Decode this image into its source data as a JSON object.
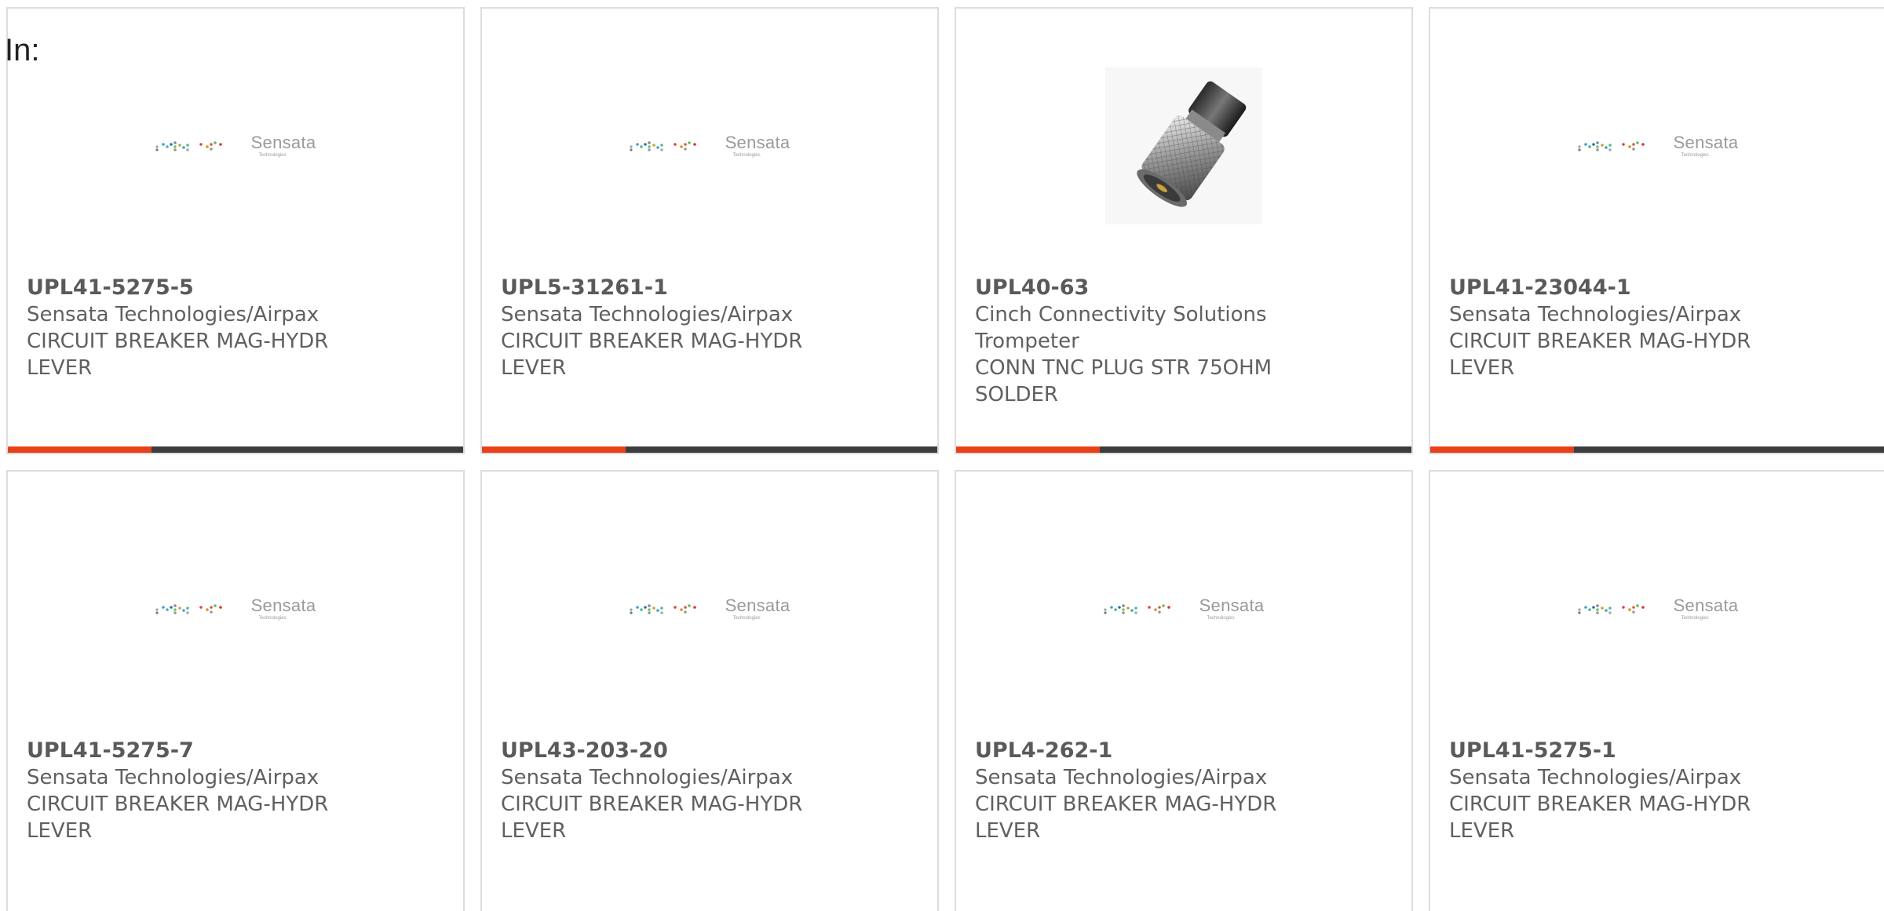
{
  "page": {
    "heading": "In:"
  },
  "logo": {
    "brand": "Sensata",
    "sub": "Technologies"
  },
  "colors": {
    "accent": "#e8411a",
    "bar": "#3d3d3d",
    "text": "#606060"
  },
  "products": [
    {
      "part_number": "UPL41-5275-5",
      "manufacturer": "Sensata Technologies/Airpax",
      "description": "CIRCUIT BREAKER MAG-HYDR LEVER",
      "image": "sensata-logo"
    },
    {
      "part_number": "UPL5-31261-1",
      "manufacturer": "Sensata Technologies/Airpax",
      "description": "CIRCUIT BREAKER MAG-HYDR LEVER",
      "image": "sensata-logo"
    },
    {
      "part_number": "UPL40-63",
      "manufacturer": "Cinch Connectivity Solutions Trompeter",
      "description": "CONN TNC PLUG STR 75OHM SOLDER",
      "image": "tnc-connector-photo"
    },
    {
      "part_number": "UPL41-23044-1",
      "manufacturer": "Sensata Technologies/Airpax",
      "description": "CIRCUIT BREAKER MAG-HYDR LEVER",
      "image": "sensata-logo"
    },
    {
      "part_number": "UPL41-5275-7",
      "manufacturer": "Sensata Technologies/Airpax",
      "description": "CIRCUIT BREAKER MAG-HYDR LEVER",
      "image": "sensata-logo"
    },
    {
      "part_number": "UPL43-203-20",
      "manufacturer": "Sensata Technologies/Airpax",
      "description": "CIRCUIT BREAKER MAG-HYDR LEVER",
      "image": "sensata-logo"
    },
    {
      "part_number": "UPL4-262-1",
      "manufacturer": "Sensata Technologies/Airpax",
      "description": "CIRCUIT BREAKER MAG-HYDR LEVER",
      "image": "sensata-logo"
    },
    {
      "part_number": "UPL41-5275-1",
      "manufacturer": "Sensata Technologies/Airpax",
      "description": "CIRCUIT BREAKER MAG-HYDR LEVER",
      "image": "sensata-logo"
    }
  ]
}
